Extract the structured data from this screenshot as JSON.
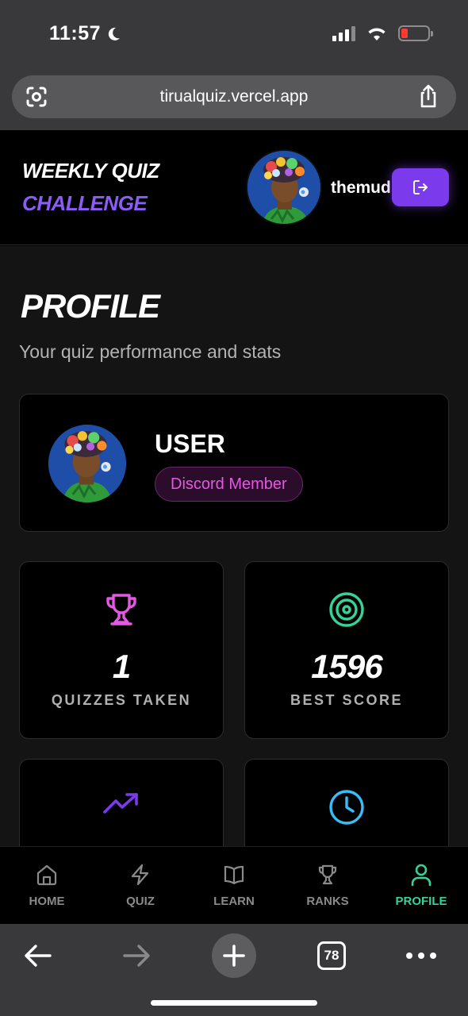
{
  "status_bar": {
    "time": "11:57"
  },
  "browser": {
    "url": "tirualquiz.vercel.app",
    "tab_count": "78"
  },
  "header": {
    "brand_line1": "WEEKLY QUIZ",
    "brand_line2": "CHALLENGE",
    "username": "themud",
    "accent_color": "#8b5cf6"
  },
  "page": {
    "title": "PROFILE",
    "subtitle": "Your quiz performance and stats"
  },
  "profile": {
    "name": "USER",
    "badge": "Discord Member"
  },
  "stats": [
    {
      "icon": "trophy-icon",
      "value": "1",
      "label": "QUIZZES TAKEN",
      "color": "#e458e4"
    },
    {
      "icon": "target-icon",
      "value": "1596",
      "label": "BEST SCORE",
      "color": "#34d399"
    },
    {
      "icon": "trending-up-icon",
      "value": "",
      "label": "",
      "color": "#7c3aed"
    },
    {
      "icon": "clock-icon",
      "value": "",
      "label": "",
      "color": "#38bdf8"
    }
  ],
  "nav": {
    "items": [
      {
        "label": "HOME",
        "icon": "home-icon"
      },
      {
        "label": "QUIZ",
        "icon": "lightning-icon"
      },
      {
        "label": "LEARN",
        "icon": "book-icon"
      },
      {
        "label": "RANKS",
        "icon": "trophy-icon"
      },
      {
        "label": "PROFILE",
        "icon": "user-icon",
        "active": true
      }
    ],
    "active_color": "#34d399"
  }
}
